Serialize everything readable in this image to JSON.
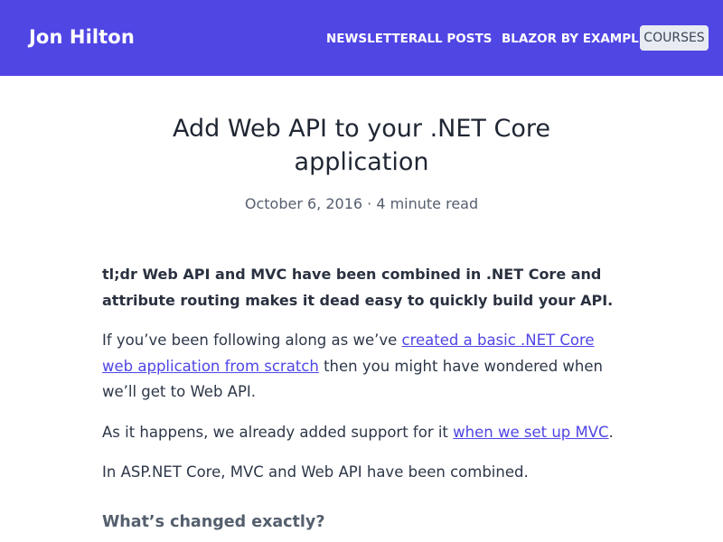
{
  "header": {
    "brand": "Jon Hilton",
    "nav": {
      "newsletter": "NEWSLETTER",
      "all_posts": "ALL POSTS",
      "blazor": "BLAZOR BY EXAMPLE",
      "courses": "COURSES"
    },
    "colors": {
      "bar": "#5046e4",
      "courses_bg": "#e8ebf2",
      "link": "#4f46e5"
    }
  },
  "post": {
    "title": "Add Web API to your .NET Core application",
    "date": "October 6, 2016",
    "separator": " · ",
    "read_time": "4 minute read"
  },
  "content": {
    "tldr": "tl;dr Web API and MVC have been combined in .NET Core and attribute routing makes it dead easy to quickly build your API.",
    "p1_before": "If you’ve been following along as we’ve ",
    "p1_link": "created a basic .NET Core web application from scratch",
    "p1_after": " then you might have wondered when we’ll get to Web API.",
    "p2_before": "As it happens, we already added support for it ",
    "p2_link": "when we set up MVC",
    "p2_after": ".",
    "p3": "In ASP.NET Core, MVC and Web API have been combined.",
    "heading": "What’s changed exactly?"
  }
}
